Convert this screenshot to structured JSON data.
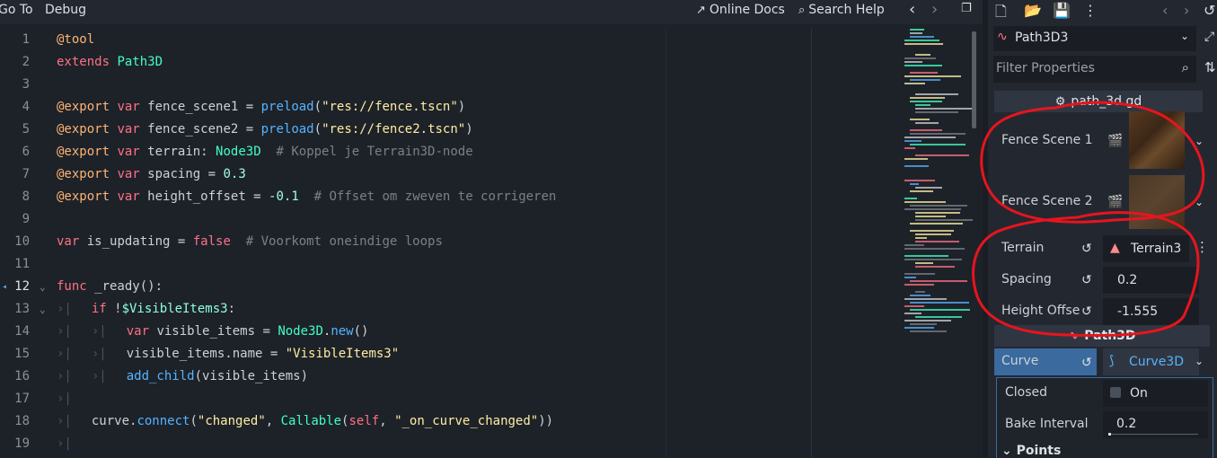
{
  "menu": {
    "goto": "Go To",
    "debug": "Debug"
  },
  "toolbar": {
    "online_docs": "Online Docs",
    "search_help": "Search Help",
    "prev": "‹",
    "next": "›"
  },
  "code": {
    "lines": [
      {
        "n": "1"
      },
      {
        "n": "2"
      },
      {
        "n": "3"
      },
      {
        "n": "4"
      },
      {
        "n": "5"
      },
      {
        "n": "6"
      },
      {
        "n": "7"
      },
      {
        "n": "8"
      },
      {
        "n": "9"
      },
      {
        "n": "10"
      },
      {
        "n": "11"
      },
      {
        "n": "12"
      },
      {
        "n": "13"
      },
      {
        "n": "14"
      },
      {
        "n": "15"
      },
      {
        "n": "16"
      },
      {
        "n": "17"
      },
      {
        "n": "18"
      },
      {
        "n": "19"
      }
    ],
    "t": {
      "tool": "@tool",
      "extends": "extends",
      "path3d": "Path3D",
      "export": "@export",
      "var": "var",
      "fence1": " fence_scene1 = ",
      "fence2": " fence_scene2 = ",
      "preload": "preload",
      "res1": "\"res://fence.tscn\"",
      "res2": "\"res://fence2.tscn\"",
      "terrain": " terrain: ",
      "node3d": "Node3D",
      "c_terrain": "  # Koppel je Terrain3D-node",
      "spacing": " spacing = ",
      "n03": "0.3",
      "height": " height_offset = ",
      "nm01": "-0.1",
      "c_offset": "  # Offset om zweven te corrigeren",
      "isupd": " is_updating = ",
      "false": "false",
      "c_loops": "  # Voorkomt oneindige loops",
      "func": "func",
      "ready": " _ready():",
      "if": "if",
      "notvis": " !",
      "visnode": "$VisibleItems3",
      "colon": ":",
      "visitems": " visible_items = ",
      "dotnew": ".",
      "new": "new",
      "parens": "()",
      "visname": "visible_items.name = ",
      "visstr": "\"VisibleItems3\"",
      "addchild": "add_child",
      "addarg": "(visible_items)",
      "curve": "curve.",
      "connect": "connect",
      "po": "(",
      "changed": "\"changed\"",
      "comma": ", ",
      "callable": "Callable",
      "self": "self",
      "oncurve": "\"_on_curve_changed\"",
      "pc": "))",
      "tab": "›|"
    }
  },
  "inspector": {
    "node_name": "Path3D3",
    "filter_placeholder": "Filter Properties",
    "script_name": "path_3d.gd",
    "props": {
      "fence1": "Fence Scene 1",
      "fence2": "Fence Scene 2",
      "terrain": "Terrain",
      "terrain_val": "Terrain3",
      "spacing": "Spacing",
      "spacing_val": "0.2",
      "height": "Height Offse",
      "height_val": "-1.555"
    },
    "section_path3d": "Path3D",
    "curve_label": "Curve",
    "curve_val": "Curve3D",
    "closed_label": "Closed",
    "closed_val": "On",
    "bake_label": "Bake Interval",
    "bake_val": "0.2",
    "points_label": "Points"
  },
  "colors": {
    "annotation": "#e8141e",
    "accent": "#5aa3e8"
  }
}
